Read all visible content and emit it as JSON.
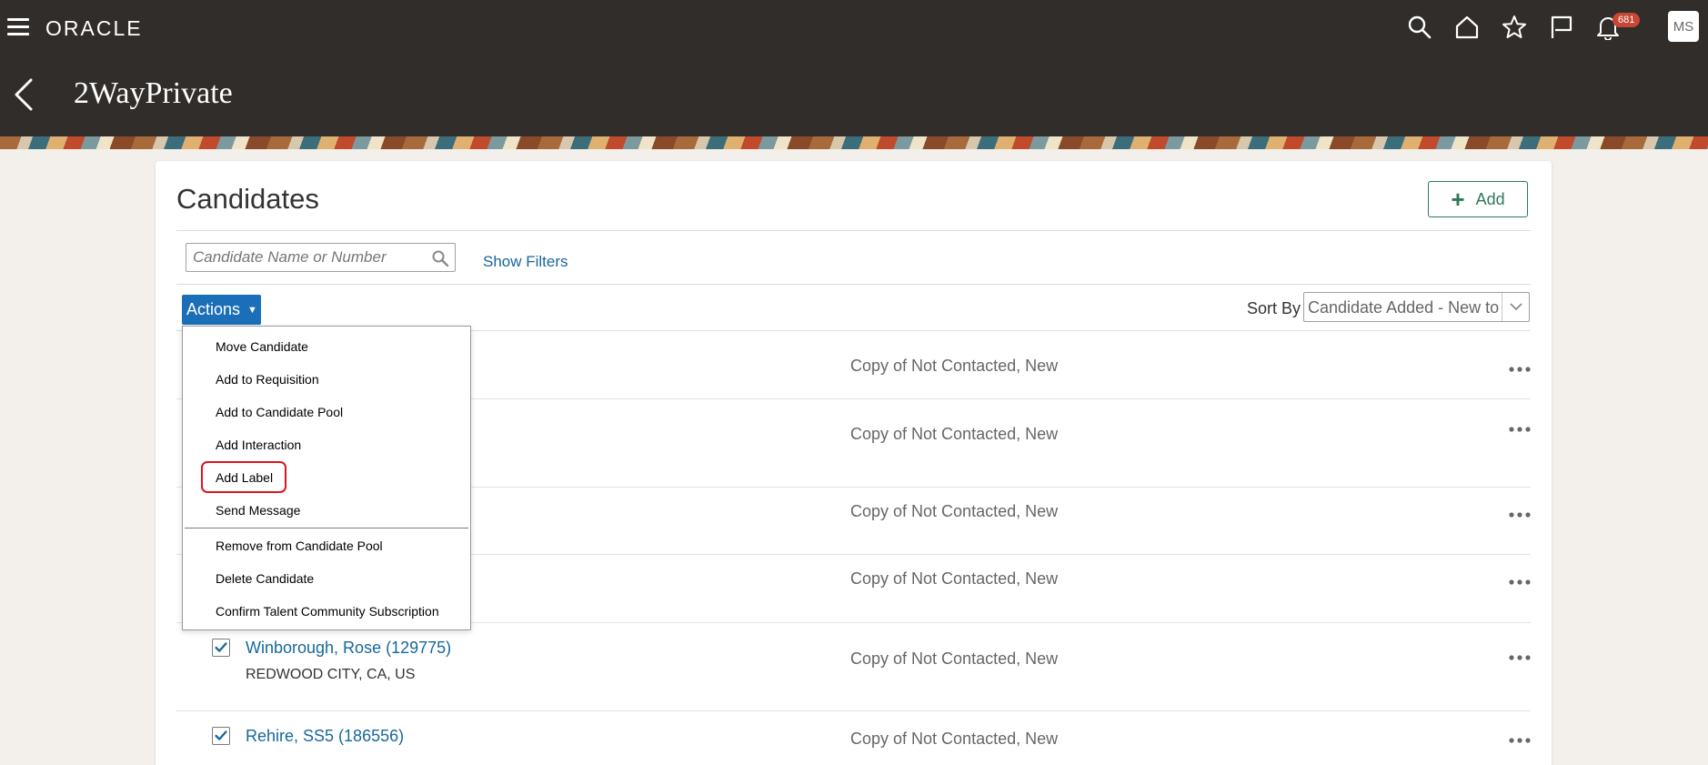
{
  "header": {
    "logo": "ORACLE",
    "page_title": "2WayPrivate",
    "notification_count": "681",
    "user_initials": "MS",
    "icons": [
      "hamburger-icon",
      "search-icon",
      "home-icon",
      "star-icon",
      "flag-icon",
      "bell-icon"
    ]
  },
  "card": {
    "title": "Candidates",
    "add_label": "Add",
    "search_placeholder": "Candidate Name or Number",
    "show_filters": "Show Filters",
    "actions_label": "Actions",
    "sort_by_label": "Sort By",
    "sort_by_value": "Candidate Added - New to Old"
  },
  "actions_menu": {
    "items": [
      "Move Candidate",
      "Add to Requisition",
      "Add to Candidate Pool",
      "Add Interaction",
      "Add Label",
      "Send Message",
      "Remove from Candidate Pool",
      "Delete Candidate",
      "Confirm Talent Community Subscription"
    ],
    "highlighted_item": "Add Label"
  },
  "rows": [
    {
      "status": "Copy of Not Contacted, New"
    },
    {
      "status": "Copy of Not Contacted, New"
    },
    {
      "status": "Copy of Not Contacted, New"
    },
    {
      "status": "Copy of Not Contacted, New"
    },
    {
      "name": "Winborough, Rose (129775)",
      "location": "REDWOOD CITY, CA, US",
      "status": "Copy of Not Contacted, New",
      "checked": true
    },
    {
      "name": "Rehire, SS5 (186556)",
      "status": "Copy of Not Contacted, New",
      "checked": true
    }
  ],
  "colors": {
    "header_bg": "#312d2a",
    "link": "#16689c",
    "actions_button": "#1a6fb8",
    "add_button": "#2d7a57",
    "badge": "#c74634",
    "highlight_ring": "#e0141e"
  }
}
